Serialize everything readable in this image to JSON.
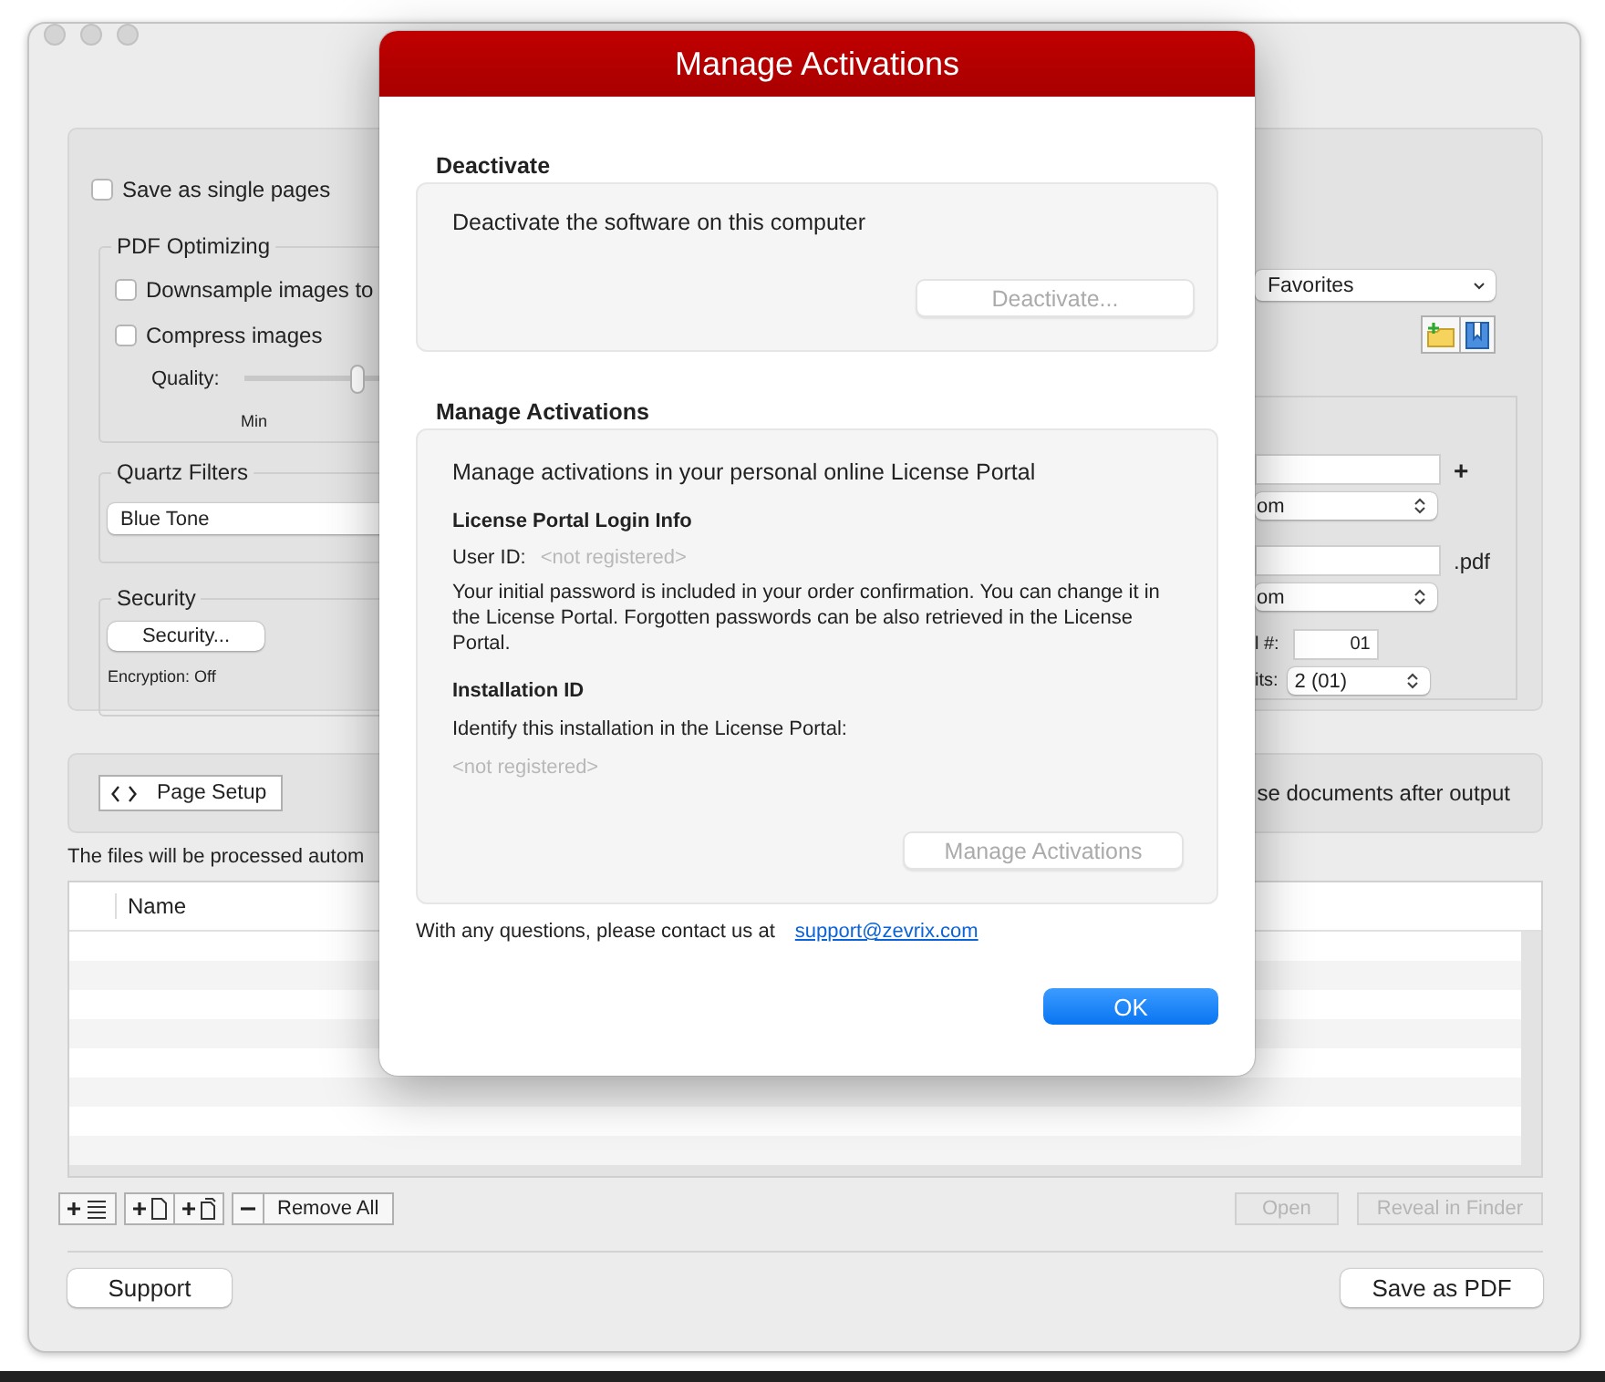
{
  "main_window": {
    "save_single_pages": {
      "label": "Save as single pages",
      "checked": false
    },
    "pdf_optimizing": {
      "title": "PDF Optimizing",
      "options": [
        {
          "label": "Downsample images to",
          "checked": false
        },
        {
          "label": "Compress images",
          "checked": false
        }
      ],
      "quality": {
        "label": "Quality:",
        "min_label": "Min",
        "level": 0.5
      }
    },
    "quartz_filters": {
      "title": "Quartz Filters",
      "value": "Blue Tone"
    },
    "security": {
      "title": "Security",
      "button": "Security...",
      "encryption": "Encryption: Off"
    },
    "favorites_select": "Favorites",
    "naming_rows": [
      {
        "kind": "field",
        "suffix": "+"
      },
      {
        "kind": "select",
        "value": "om"
      },
      {
        "kind": "field",
        "suffix": ".pdf"
      },
      {
        "kind": "select",
        "value": "om"
      },
      {
        "kind": "number",
        "label": "l #:",
        "value": "01"
      },
      {
        "kind": "digits",
        "label": "its:",
        "value": "2 (01)"
      }
    ],
    "page_setup_button": "Page Setup",
    "close_documents_text": "se documents after output",
    "info_text": "The files will be processed autom",
    "table": {
      "columns": [
        "Name"
      ]
    },
    "list_buttons": [
      {
        "kind": "add-list"
      },
      {
        "kind": "add-file"
      },
      {
        "kind": "add-files"
      },
      {
        "kind": "remove"
      }
    ],
    "remove_all_button": "Remove All",
    "action_buttons": [
      {
        "label": "Open",
        "disabled": true
      },
      {
        "label": "Reveal in Finder",
        "disabled": true
      }
    ],
    "support_button": "Support",
    "save_button": "Save as PDF"
  },
  "dialog": {
    "title": "Manage Activations",
    "deactivate": {
      "heading": "Deactivate",
      "text": "Deactivate the software on this computer",
      "button": {
        "label": "Deactivate...",
        "disabled": true
      }
    },
    "manage": {
      "heading": "Manage Activations",
      "intro": "Manage activations in your personal online License Portal",
      "login_heading": "License Portal Login Info",
      "user_id_label": "User ID:",
      "user_id_value": "<not registered>",
      "password_note": "Your initial password is included in your order confirmation. You can change it in the License Portal. Forgotten passwords can be also retrieved in the License Portal.",
      "installation_heading": "Installation ID",
      "installation_text": "Identify this installation in the License Portal:",
      "installation_value": "<not registered>",
      "button": {
        "label": "Manage Activations",
        "disabled": true
      }
    },
    "contact_text": "With any questions, please contact us at",
    "contact_link": "support@zevrix.com",
    "ok_button": "OK"
  }
}
